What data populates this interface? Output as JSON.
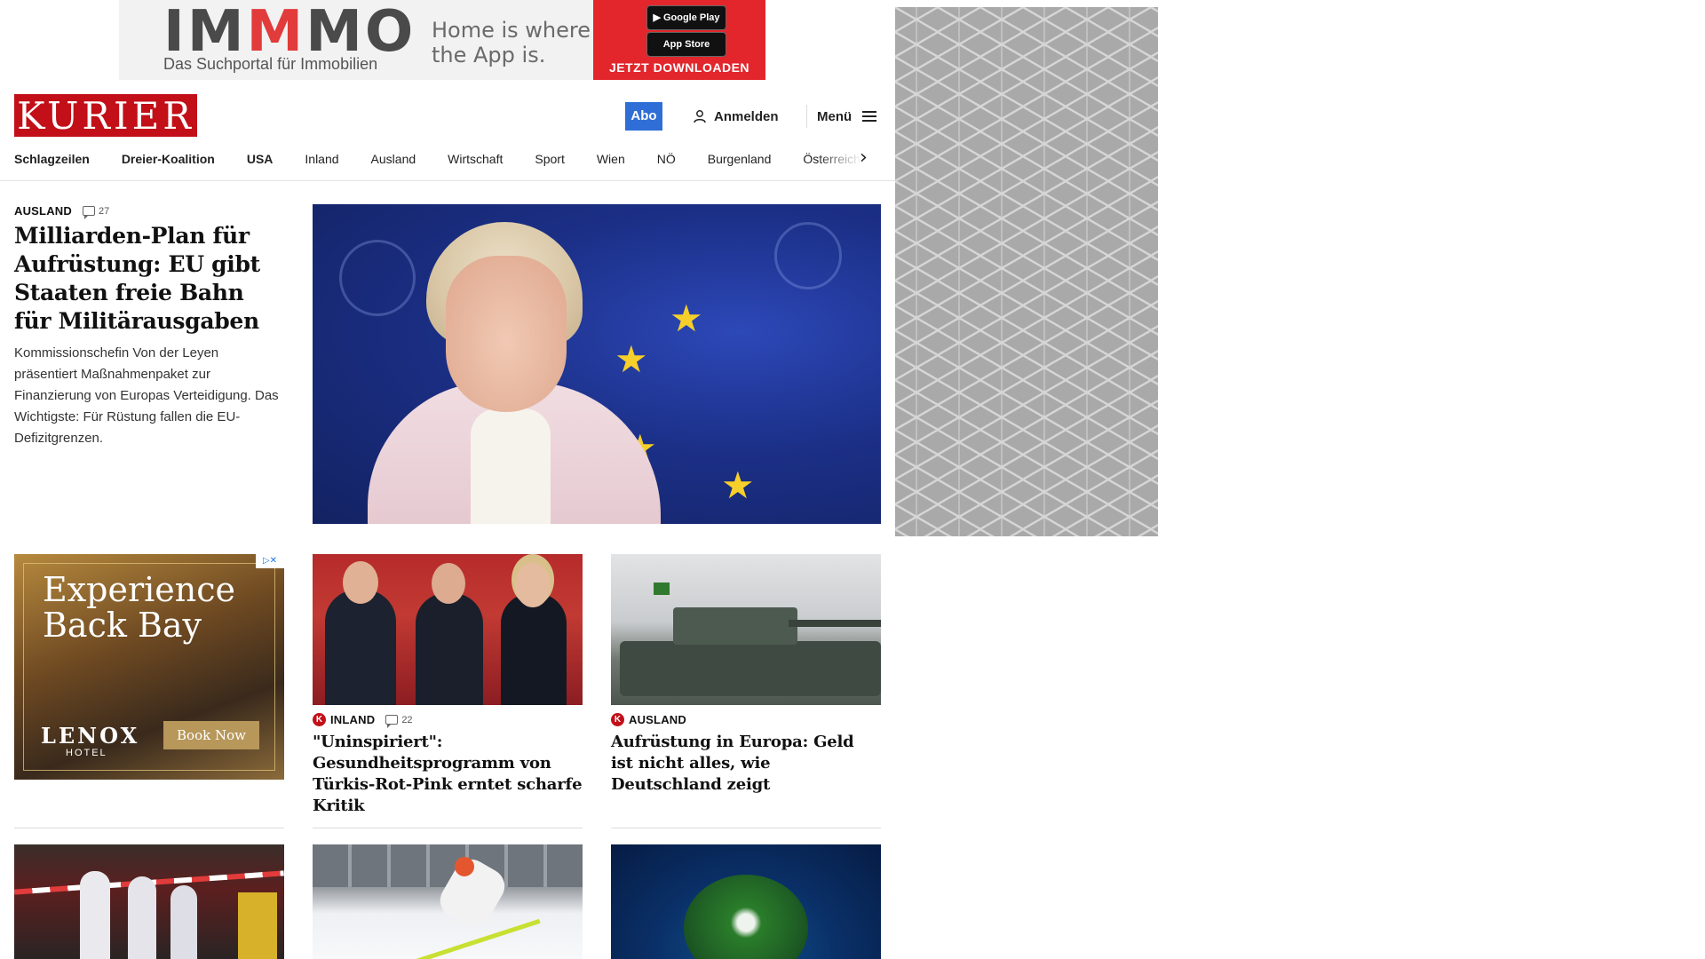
{
  "top_ad": {
    "brand": "IMMMO",
    "subtitle": "Das Suchportal für Immobilien",
    "tagline": "Home is where the App is.",
    "google_play": "Google Play",
    "app_store": "App Store",
    "cta": "JETZT DOWNLOADEN"
  },
  "header": {
    "logo": "KURIER",
    "abo": "Abo",
    "login": "Anmelden",
    "menu": "Menü"
  },
  "nav": {
    "items": [
      "Schlagzeilen",
      "Dreier-Koalition",
      "USA",
      "Inland",
      "Ausland",
      "Wirtschaft",
      "Sport",
      "Wien",
      "NÖ",
      "Burgenland",
      "Österreich"
    ]
  },
  "lead": {
    "category": "AUSLAND",
    "comments": "27",
    "title": "Milliarden-Plan für Aufrüstung: EU gibt Staaten freie Bahn für Militärausgaben",
    "teaser": "Kommissionschefin Von der Leyen präsentiert Maßnahmenpaket zur Finanzierung von Europas Verteidigung. Das Wichtigste: Für Rüstung fallen die EU-Defizitgrenzen."
  },
  "ad_hotel": {
    "headline": "Experience Back Bay",
    "logo": "LENOX",
    "hotel": "HOTEL",
    "button": "Book Now"
  },
  "cards": [
    {
      "category": "INLAND",
      "comments": "22",
      "title": "\"Uninspiriert\": Gesundheitsprogramm von Türkis-Rot-Pink erntet scharfe Kritik"
    },
    {
      "category": "AUSLAND",
      "title": "Aufrüstung in Europa: Geld ist nicht alles, wie Deutschland zeigt"
    }
  ],
  "colors": {
    "brand_red": "#c20f18",
    "abo_blue": "#2f6ed6"
  }
}
